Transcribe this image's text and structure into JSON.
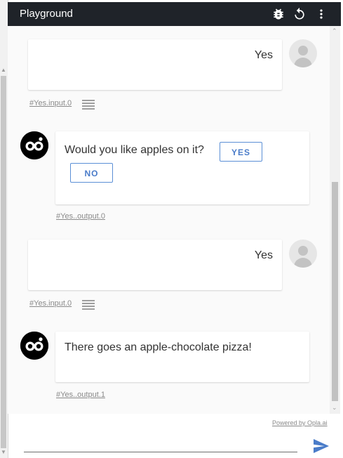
{
  "header": {
    "title": "Playground",
    "icons": [
      "bug-icon",
      "refresh-icon",
      "more-vertical-icon"
    ]
  },
  "messages": [
    {
      "from": "user",
      "text": "Yes",
      "ref": "#Yes.input.0"
    },
    {
      "from": "bot",
      "text": "Would you like apples on it?",
      "ref": "#Yes..output.0",
      "choices": [
        "YES",
        "NO"
      ]
    },
    {
      "from": "user",
      "text": "Yes",
      "ref": "#Yes.input.0"
    },
    {
      "from": "bot",
      "text": "There goes an apple-chocolate pizza!",
      "ref": "#Yes..output.1"
    }
  ],
  "footer": {
    "powered_by": "Powered by Opla.ai",
    "input_value": "",
    "input_placeholder": ""
  },
  "colors": {
    "header_bg": "#1f2329",
    "accent": "#4a7cc9",
    "send": "#4a7cc9"
  }
}
